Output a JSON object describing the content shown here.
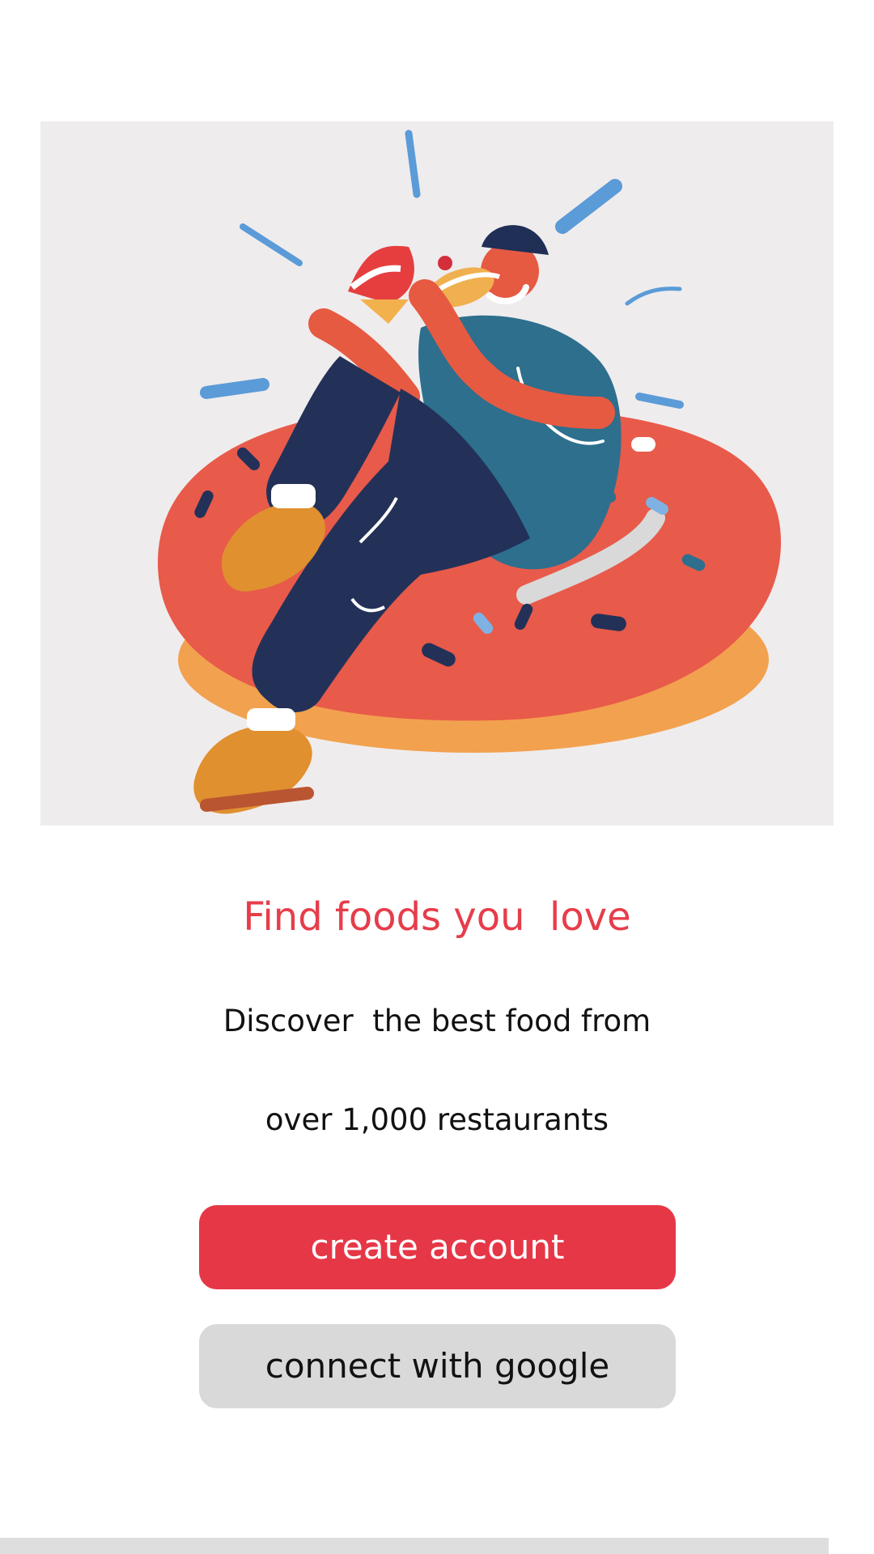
{
  "onboarding": {
    "headline": "Find foods you  love",
    "description_line1": "Discover  the best food from",
    "description_line2": "over 1,000 restaurants",
    "create_account_label": "create account",
    "google_label": "connect with google"
  },
  "colors": {
    "accent": "#e63747",
    "secondary_button": "#d9d9d9",
    "illustration_background": "#efeced"
  },
  "icons": {
    "hero": "person-eating-on-donut-illustration"
  }
}
